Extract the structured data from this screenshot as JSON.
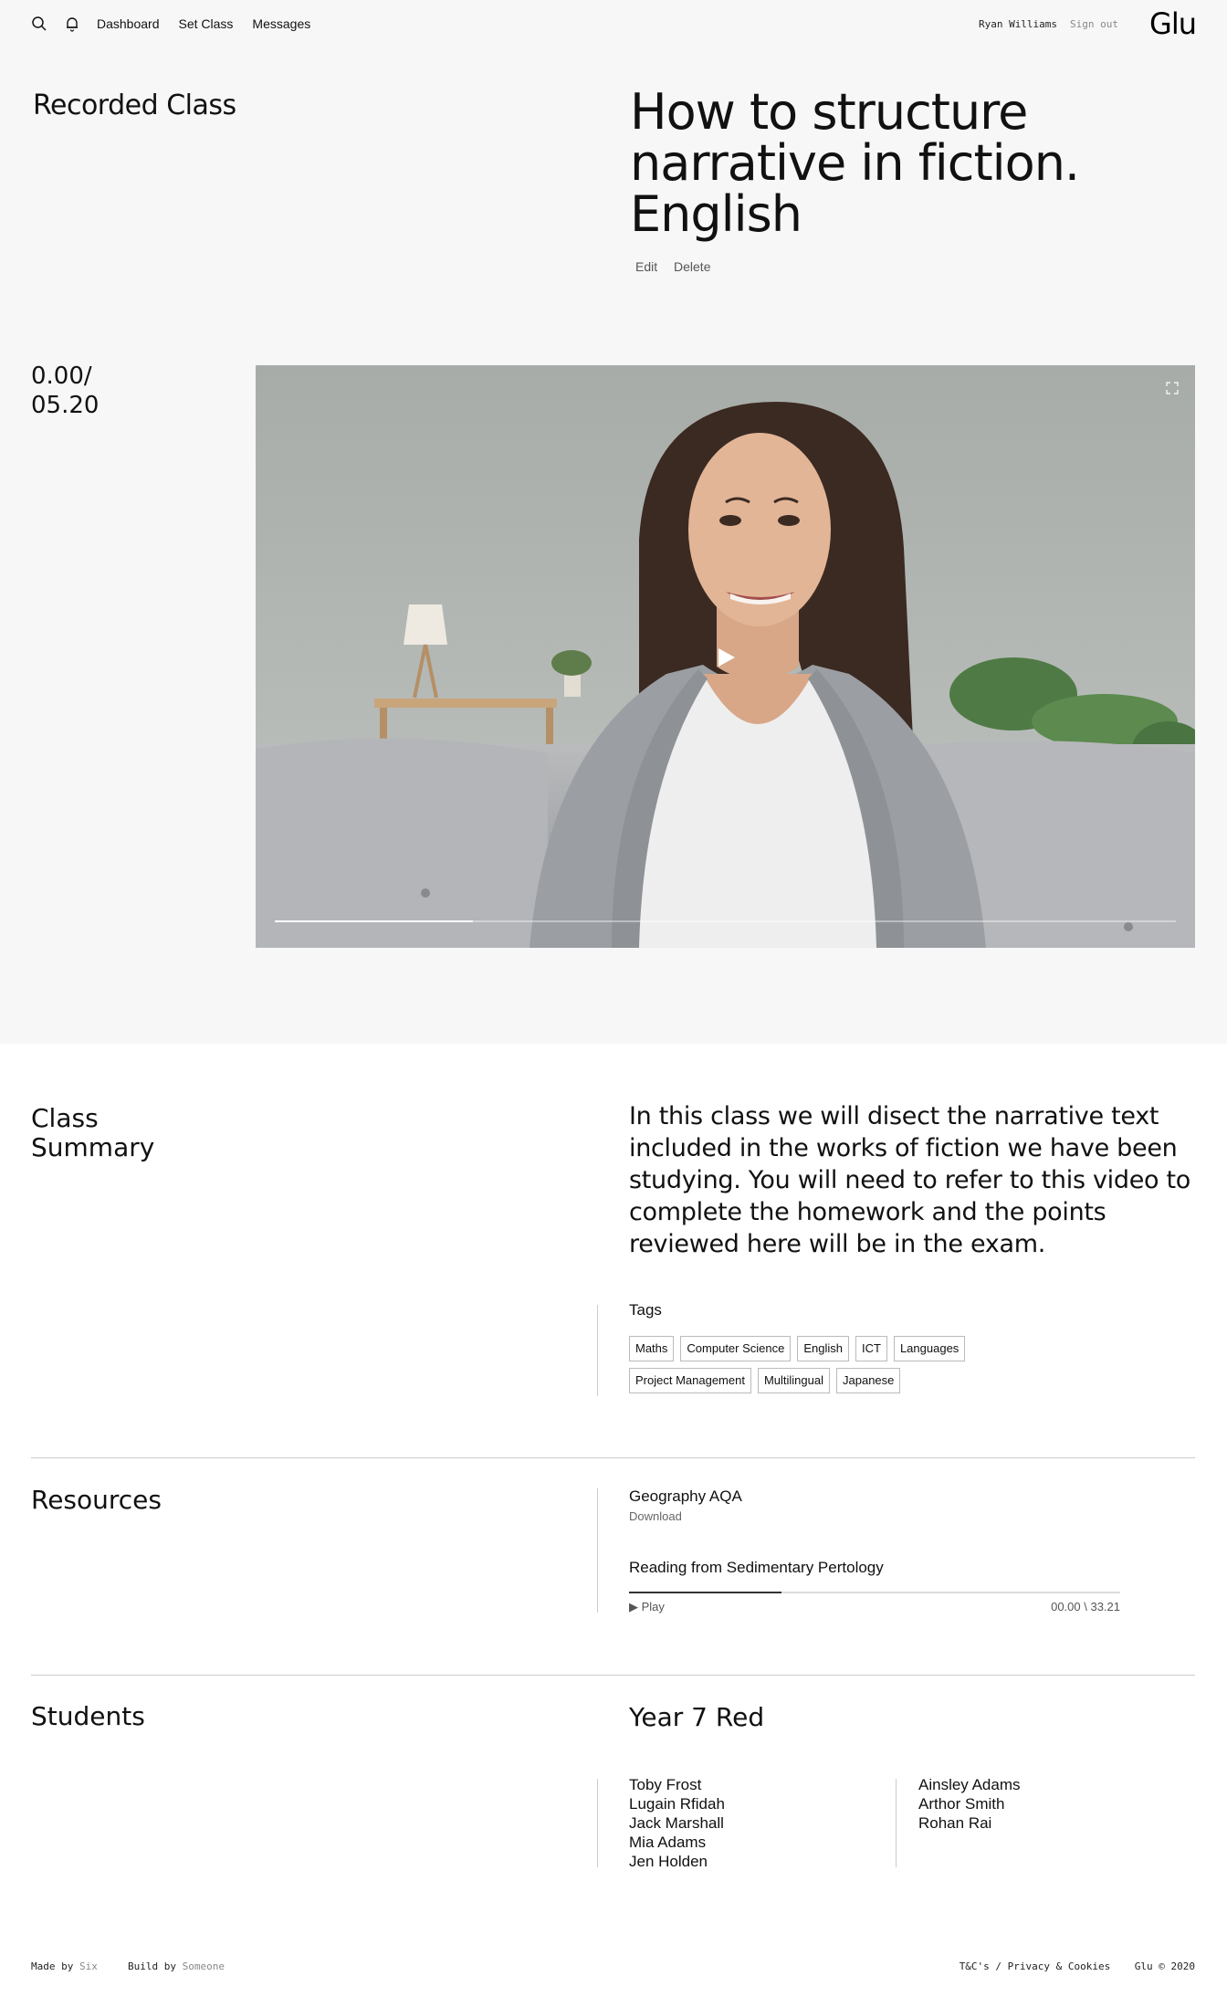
{
  "nav": {
    "search_icon": "search-icon",
    "bell_icon": "bell-icon",
    "links": [
      "Dashboard",
      "Set Class",
      "Messages"
    ],
    "user_name": "Ryan Williams",
    "sign_out": "Sign out",
    "logo": "Glu"
  },
  "header": {
    "page_label": "Recorded Class",
    "title_lines": [
      "How to structure",
      "narrative in fiction.",
      "English"
    ],
    "actions": [
      "Edit",
      "Delete"
    ]
  },
  "video": {
    "time_current": "0.00/",
    "time_total": "05.20",
    "progress": 0.22,
    "expand_icon": "expand-icon",
    "play_icon": "play-icon"
  },
  "summary": {
    "heading_lines": [
      "Class",
      "Summary"
    ],
    "text": "In this class we will disect the narrative text included in the works of fiction we have been studying. You will need to refer to this video to complete the homework and the points reviewed here will be in the exam.",
    "tags_label": "Tags",
    "tags": [
      "Maths",
      "Computer Science",
      "English",
      "ICT",
      "Languages",
      "Project Management",
      "Multilingual",
      "Japanese"
    ]
  },
  "resources": {
    "heading": "Resources",
    "items": [
      {
        "title": "Geography AQA",
        "action": "Download"
      },
      {
        "title": "Reading from Sedimentary Pertology",
        "action": "Play",
        "time": "00.00 \\ 33.21",
        "progress": 0.31
      }
    ]
  },
  "students": {
    "heading": "Students",
    "group": "Year 7 Red",
    "column1": [
      "Toby Frost",
      "Lugain Rfidah",
      "Jack Marshall",
      "Mia Adams",
      "Jen Holden"
    ],
    "column2": [
      "Ainsley Adams",
      "Arthor Smith",
      "Rohan Rai"
    ]
  },
  "footer": {
    "made_by_label": "Made by",
    "made_by": "Six",
    "build_by_label": "Build by",
    "build_by": "Someone",
    "links": "T&C's / Privacy & Cookies",
    "copyright": "Glu © 2020"
  },
  "colors": {
    "top_background": "#f7f7f7",
    "page_background": "#ffffff",
    "divider": "#cccccc"
  }
}
